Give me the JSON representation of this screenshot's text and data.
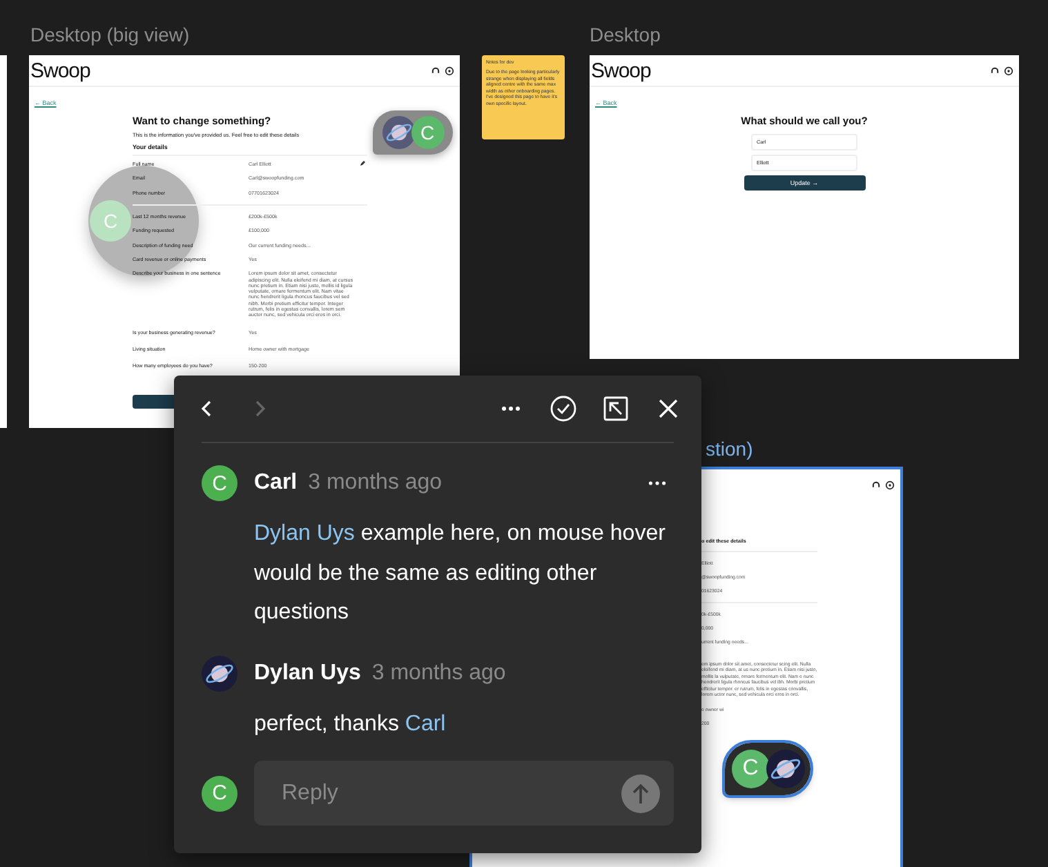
{
  "details_frame": {
    "title": "Desktop (big view)",
    "selected": false,
    "logo": "Swoop",
    "back": "← Back",
    "heading": "Want to change something?",
    "intro": "This is the information you've provided us. Feel free to edit these details",
    "section": "Your details",
    "rows": [
      {
        "label": "Full name",
        "value": "Carl Elliott"
      },
      {
        "label": "Email",
        "value": "Carl@swoopfunding.com"
      },
      {
        "label": "Phone number",
        "value": "07701623024"
      },
      {
        "label": "Last 12 months revenue",
        "value": "£200k-£500k"
      },
      {
        "label": "Funding requested",
        "value": "£100,000"
      },
      {
        "label": "Description of funding need",
        "value": "Our current funding needs..."
      },
      {
        "label": "Card revenue or online payments",
        "value": "Yes"
      },
      {
        "label": "Describe your business in one sentence",
        "value": "Lorem ipsum dolor sit amet, consectetur adipiscing elit. Nulla eleifend mi diam, at cursus nunc pretium in. Etiam nisi justo, mollis id ligula vulputate, ornare fermentum elit. Nam vitae nunc hendrerit ligula rhoncus faucibus vel sed nibh. Morbi pretium efficitur tempor. Integer rutrum, felis in egestas convallis, lorem sem auctor nunc, sed vehicula orci eros in orci."
      },
      {
        "label": "Is your business generating revenue?",
        "value": "Yes"
      },
      {
        "label": "Living situation",
        "value": "Home owner with mortgage"
      },
      {
        "label": "How many employees do you have?",
        "value": "150-200"
      }
    ],
    "pin": {
      "letter": "C",
      "selected": false
    },
    "cursor_preview": {
      "letter": "C"
    }
  },
  "sticky_note": {
    "title": "Notes for dev",
    "text": "Due to the page looking particularly strange when displaying all fields aligned centre with the same max width as other onboarding pages. I've designed this page to have it's own specific layout."
  },
  "name_frame": {
    "title": "Desktop",
    "logo": "Swoop",
    "back": "← Back",
    "heading": "What should we call you?",
    "fields": [
      {
        "value": "Carl"
      },
      {
        "value": "Elliott"
      }
    ],
    "button": "Update →"
  },
  "partial_frame": {
    "title": "stion)",
    "selected": true,
    "heading": "o edit these details",
    "rows": [
      "Elliott",
      "@swoopfunding.com",
      "01623024",
      "0k-£500k",
      "0,000",
      "urrent funding needs..."
    ],
    "paragraph": "em ipsum dolor sit amet, consectetur scing elit. Nulla eleifend mi diam, at us nunc pretium in. Etiam nisi justo, mollis la vulputate, ornare fermentum elit. Nam e nunc hendrerit ligula rhoncus faucibus vel ibh. Morbi pretium efficitur tempor. er rutrum, felis in egestas convallis, lorem uctor nunc, sed vehicula orci eros in orci.",
    "rows_after": [
      "e owner wi",
      "200"
    ],
    "pin": {
      "letter": "C",
      "selected": true
    }
  },
  "comment_popup": {
    "nav": {
      "previous_disabled": false,
      "next_disabled": true
    },
    "comments": [
      {
        "author": "Carl",
        "avatar": {
          "kind": "initial",
          "letter": "C"
        },
        "time": "3 months ago",
        "has_menu": true,
        "parts": [
          {
            "text": "Dylan Uys",
            "mention": true
          },
          {
            "text": " example here, on mouse hover would be the same as editing other questions",
            "mention": false
          }
        ]
      },
      {
        "author": "Dylan Uys",
        "avatar": {
          "kind": "planet"
        },
        "time": "3 months ago",
        "has_menu": false,
        "parts": [
          {
            "text": "perfect, thanks ",
            "mention": false
          },
          {
            "text": "Carl",
            "mention": true
          }
        ]
      }
    ],
    "reply": {
      "avatar_letter": "C",
      "placeholder": "Reply"
    }
  }
}
